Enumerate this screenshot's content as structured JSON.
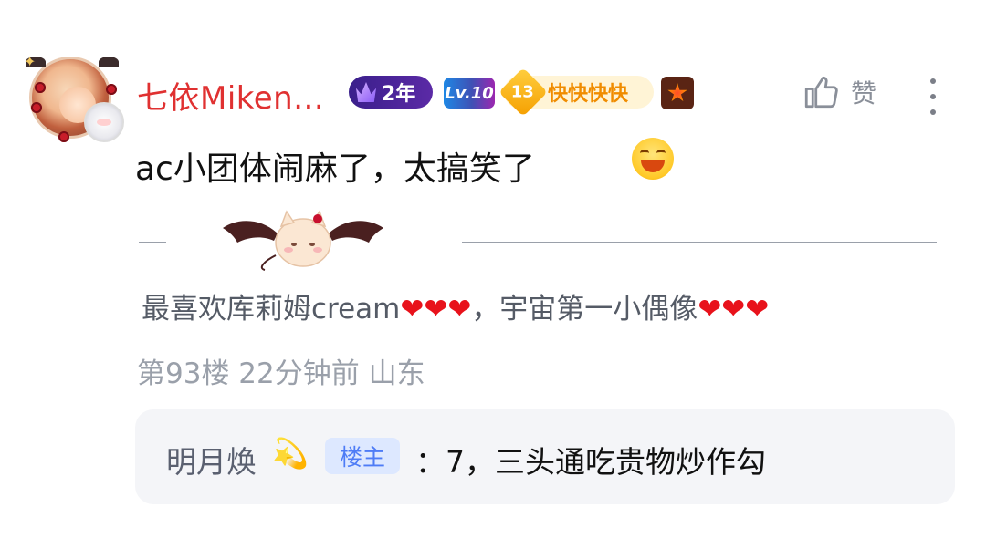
{
  "comment": {
    "username": "七依Miken...",
    "badges": {
      "years": "2年",
      "level": "Lv.10",
      "fan_level": "13",
      "fan_title": "快快快快"
    },
    "like_label": "赞",
    "text": "ac小团体闹麻了，太搞笑了",
    "signature": {
      "part1": "最喜欢库莉姆cream",
      "hearts": "❤❤❤",
      "part2": "，宇宙第一小偶像",
      "hearts2": "❤❤❤"
    },
    "meta": "第93楼 22分钟前 山东",
    "icons": [
      "avatar",
      "crown-icon",
      "medal-icon",
      "thumbs-up-icon",
      "more-vertical-icon",
      "laughing-emoji",
      "devil-cat-mascot",
      "dizzy-star-emoji"
    ]
  },
  "reply": {
    "name": "明月焕",
    "emoji": "💫",
    "owner_tag": "楼主",
    "text": "：7，三头通吃贵物炒作勾"
  },
  "colors": {
    "username": "#e03131",
    "meta": "#9aa0aa",
    "reply_bg": "#f4f5f8",
    "owner_tag_bg": "#dde8ff",
    "owner_tag_text": "#4e7cf6"
  }
}
